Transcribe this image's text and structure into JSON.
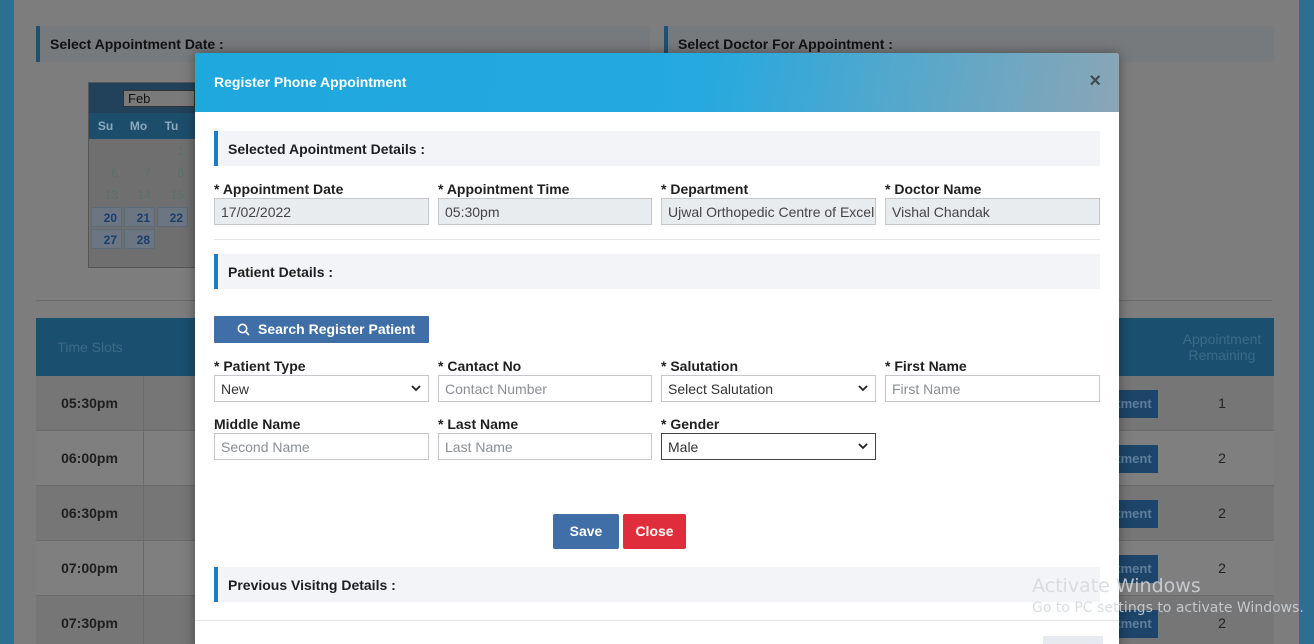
{
  "background": {
    "section_left": "Select Appointment Date :",
    "section_right": "Select Doctor For Appointment :",
    "calendar": {
      "month": "Feb",
      "weekdays": [
        "Su",
        "Mo",
        "Tu"
      ],
      "rows": [
        [
          "",
          "",
          "1"
        ],
        [
          "6",
          "7",
          "8"
        ],
        [
          "13",
          "14",
          "15"
        ],
        [
          "20",
          "21",
          "22"
        ],
        [
          "27",
          "28",
          ""
        ]
      ]
    },
    "table": {
      "col_time_slots": "Time Slots",
      "col_remaining": "Appointment Remaining",
      "rows": [
        {
          "time": "05:30pm",
          "action": "ntment",
          "remaining": "1"
        },
        {
          "time": "06:00pm",
          "action": "ntment",
          "remaining": "2"
        },
        {
          "time": "06:30pm",
          "action": "ntment",
          "remaining": "2"
        },
        {
          "time": "07:00pm",
          "action": "ntment",
          "remaining": "2"
        },
        {
          "time": "07:30pm",
          "action": "ntment",
          "remaining": "2"
        }
      ]
    }
  },
  "modal": {
    "title": "Register Phone Appointment",
    "close_symbol": "×",
    "selected_section": "Selected Apointment Details :",
    "appointment_date_label": "* Appointment Date",
    "appointment_date_value": "17/02/2022",
    "appointment_time_label": "* Appointment Time",
    "appointment_time_value": "05:30pm",
    "department_label": "* Department",
    "department_value": "Ujwal Orthopedic Centre of Excellence",
    "doctor_name_label": "* Doctor Name",
    "doctor_name_value": "Vishal Chandak",
    "patient_section": "Patient Details :",
    "search_button": "Search Register Patient",
    "patient_type_label": "* Patient Type",
    "patient_type_value": "New",
    "contact_label": "* Cantact No",
    "contact_placeholder": "Contact Number",
    "salutation_label": "* Salutation",
    "salutation_value": "Select Salutation",
    "first_name_label": "* First Name",
    "first_name_placeholder": "First Name",
    "middle_name_label": "Middle Name",
    "middle_name_placeholder": "Second Name",
    "last_name_label": "* Last Name",
    "last_name_placeholder": "Last Name",
    "gender_label": "* Gender",
    "gender_value": "Male",
    "save_button": "Save",
    "close_button": "Close",
    "previous_section": "Previous Visitng Details :"
  },
  "watermark": {
    "title": "Activate Windows",
    "subtitle": "Go to PC settings to activate Windows."
  }
}
